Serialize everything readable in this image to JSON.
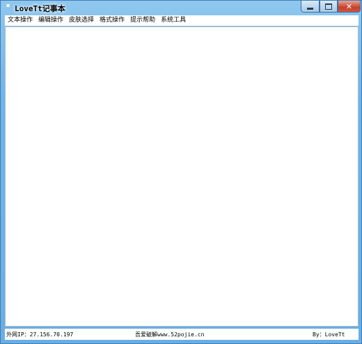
{
  "window": {
    "title": "LoveTt记事本",
    "controls": {
      "minimize_icon": "minimize-icon",
      "maximize_icon": "maximize-icon",
      "close_icon": "close-icon",
      "close_glyph": "✕"
    }
  },
  "menu": {
    "items": [
      {
        "label": "文本操作"
      },
      {
        "label": "编辑操作"
      },
      {
        "label": "皮肤选择"
      },
      {
        "label": "格式操作"
      },
      {
        "label": "提示帮助"
      },
      {
        "label": "系统工具"
      }
    ]
  },
  "editor": {
    "content": ""
  },
  "status": {
    "ip": "外网IP：27.156.70.197",
    "site": "吾爱破解www.52pojie.cn",
    "author": "By：LoveTt"
  },
  "colors": {
    "window_frame": "#6fb3e8",
    "close_button": "#c7402c"
  }
}
